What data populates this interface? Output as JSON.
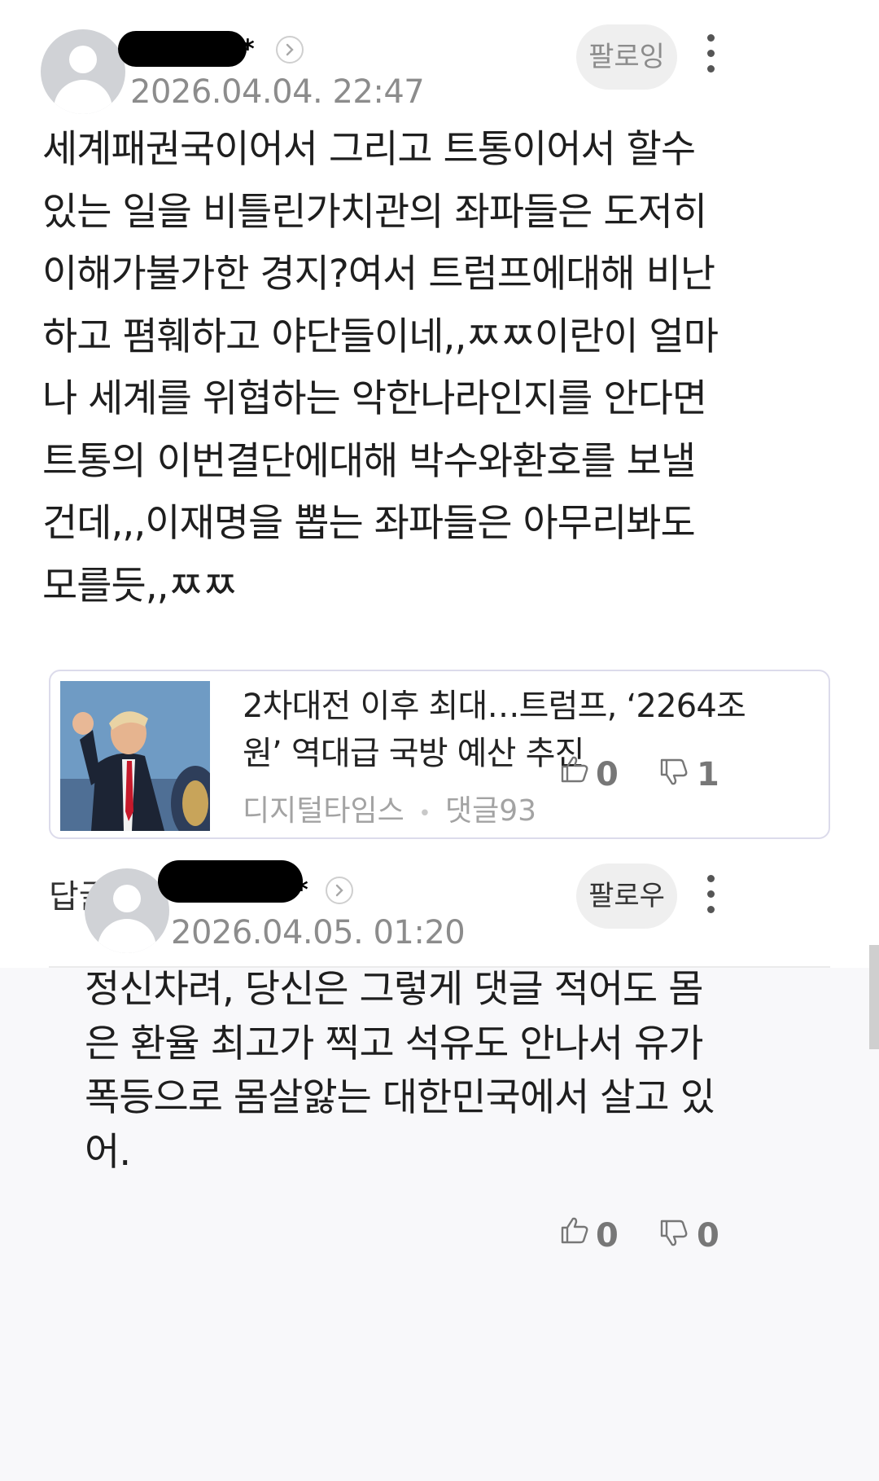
{
  "comment": {
    "username": "*",
    "timestamp": "2026.04.04. 22:47",
    "follow_label": "팔로잉",
    "text_lines": [
      "세계패권국이어서 그리고 트통이어서 할수",
      "있는 일을 비틀린가치관의 좌파들은 도저히",
      "이해가불가한 경지?여서 트럼프에대해 비난",
      "하고 폄훼하고 야단들이네,,ㅉㅉ이란이 얼마",
      "나 세계를 위협하는 악한나라인지를 안다면",
      "트통의 이번결단에대해 박수와환호를 보낼",
      "건데,,,이재명을 뽑는 좌파들은 아무리봐도",
      "모를듯,,ㅉㅉ"
    ],
    "article": {
      "title_line1": "2차대전 이후 최대…트럼프, ‘2264조",
      "title_line2": "원’ 역대급 국방 예산 추진",
      "source": "디지털타임스",
      "separator": "•",
      "comment_count": "댓글93"
    },
    "reply_label": "답글",
    "reply_count": "1",
    "likes": "0",
    "dislikes": "1"
  },
  "reply": {
    "username": "*",
    "timestamp": "2026.04.05. 01:20",
    "follow_label": "팔로우",
    "text_lines": [
      "정신차려, 당신은 그렇게 댓글 적어도 몸",
      "은 환율 최고가 찍고 석유도 안나서 유가",
      "폭등으로 몸살앓는 대한민국에서 살고 있",
      "어."
    ],
    "likes": "0",
    "dislikes": "0"
  },
  "icons": [
    "avatar-icon",
    "chevron-right-icon",
    "more-vertical-icon",
    "thumbs-up-icon",
    "thumbs-down-icon"
  ],
  "colors": {
    "reply_background": "#f8f8fa",
    "timestamp": "#8c8c8c",
    "card_border": "#dcdbeb"
  }
}
